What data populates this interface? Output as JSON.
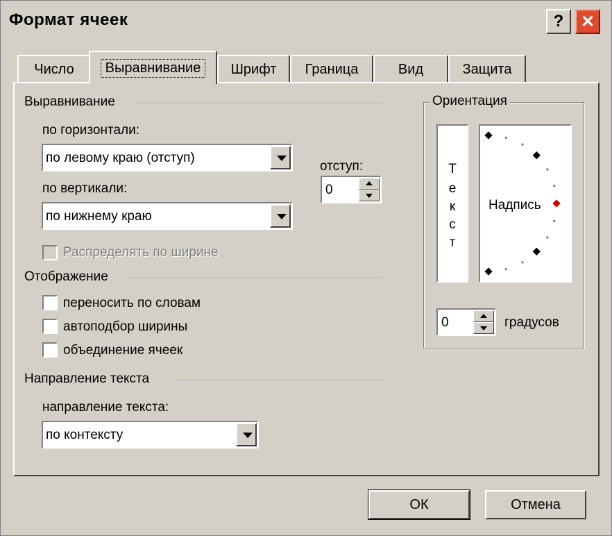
{
  "window": {
    "title": "Формат ячеек",
    "help": "?",
    "close": "✕"
  },
  "tabs": [
    {
      "label": "Число"
    },
    {
      "label": "Выравнивание",
      "active": true
    },
    {
      "label": "Шрифт"
    },
    {
      "label": "Граница"
    },
    {
      "label": "Вид"
    },
    {
      "label": "Защита"
    }
  ],
  "alignment": {
    "group": "Выравнивание",
    "horizontal_label": "по горизонтали:",
    "horizontal_value": "по левому краю (отступ)",
    "vertical_label": "по вертикали:",
    "vertical_value": "по нижнему краю",
    "indent_label": "отступ:",
    "indent_value": "0",
    "distribute_label": "Распределять по ширине"
  },
  "display": {
    "group": "Отображение",
    "wrap_label": "переносить по словам",
    "shrink_label": "автоподбор ширины",
    "merge_label": "объединение ячеек"
  },
  "direction": {
    "group": "Направление текста",
    "label": "направление текста:",
    "value": "по контексту"
  },
  "orientation": {
    "group": "Ориентация",
    "vertical_text": [
      "Т",
      "е",
      "к",
      "с",
      "т"
    ],
    "dial_text": "Надпись",
    "degrees_value": "0",
    "degrees_label": "градусов"
  },
  "buttons": {
    "ok": "ОК",
    "cancel": "Отмена"
  },
  "colors": {
    "marker_active": "#d00000",
    "marker": "#000000",
    "dot": "#808080"
  }
}
